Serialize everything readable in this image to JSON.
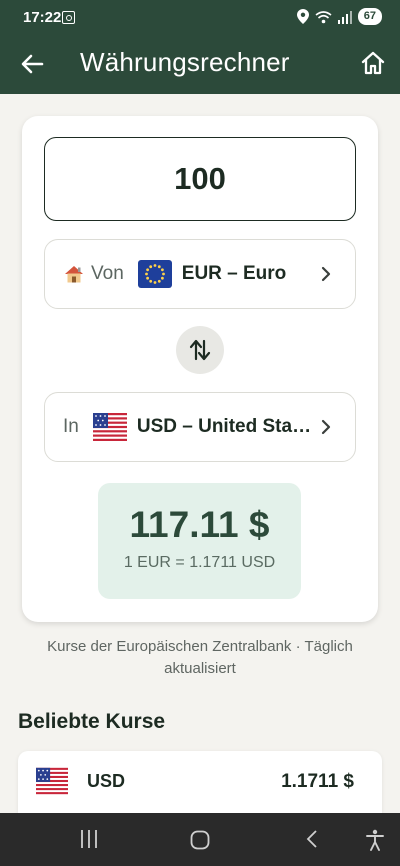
{
  "status": {
    "time": "17:22",
    "battery": "67"
  },
  "appbar": {
    "title": "Währungsrechner"
  },
  "converter": {
    "amount": "100",
    "from": {
      "label": "Von",
      "code": "EUR – Euro"
    },
    "to": {
      "label": "In",
      "code": "USD – United States Dollar"
    },
    "result": "117.11 $",
    "rate": "1 EUR = 1.1711 USD"
  },
  "note": "Kurse der Europäischen Zentralbank · Täglich aktualisiert",
  "popular": {
    "title": "Beliebte Kurse",
    "rows": [
      {
        "code": "USD",
        "value": "1.1711 $"
      }
    ]
  },
  "colors": {
    "brand": "#2c4a3a",
    "result_bg": "#e3f1ea",
    "background": "#f4f3ef"
  }
}
